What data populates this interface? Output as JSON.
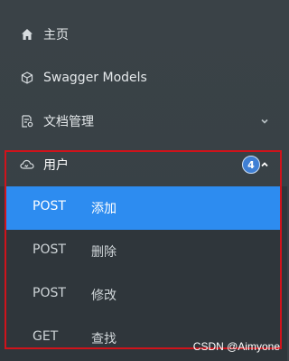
{
  "colors": {
    "sidebar_bg": "#3a4247",
    "submenu_bg": "#2f363b",
    "active_bg": "#2d8cf0",
    "highlight_border": "#d0131b",
    "badge_bg": "#3f7fd4"
  },
  "nav": {
    "home": {
      "label": "主页",
      "icon": "home-icon"
    },
    "swagger_models": {
      "label": "Swagger Models",
      "icon": "cube-icon"
    },
    "doc_manage": {
      "label": "文档管理",
      "icon": "doc-settings-icon"
    },
    "user": {
      "label": "用户",
      "icon": "cloud-icon",
      "badge": "4"
    }
  },
  "submenu": [
    {
      "method": "POST",
      "action": "添加",
      "active": true
    },
    {
      "method": "POST",
      "action": "删除"
    },
    {
      "method": "POST",
      "action": "修改"
    },
    {
      "method": "GET",
      "action": "查找"
    }
  ],
  "watermark": "CSDN @Aimyone"
}
